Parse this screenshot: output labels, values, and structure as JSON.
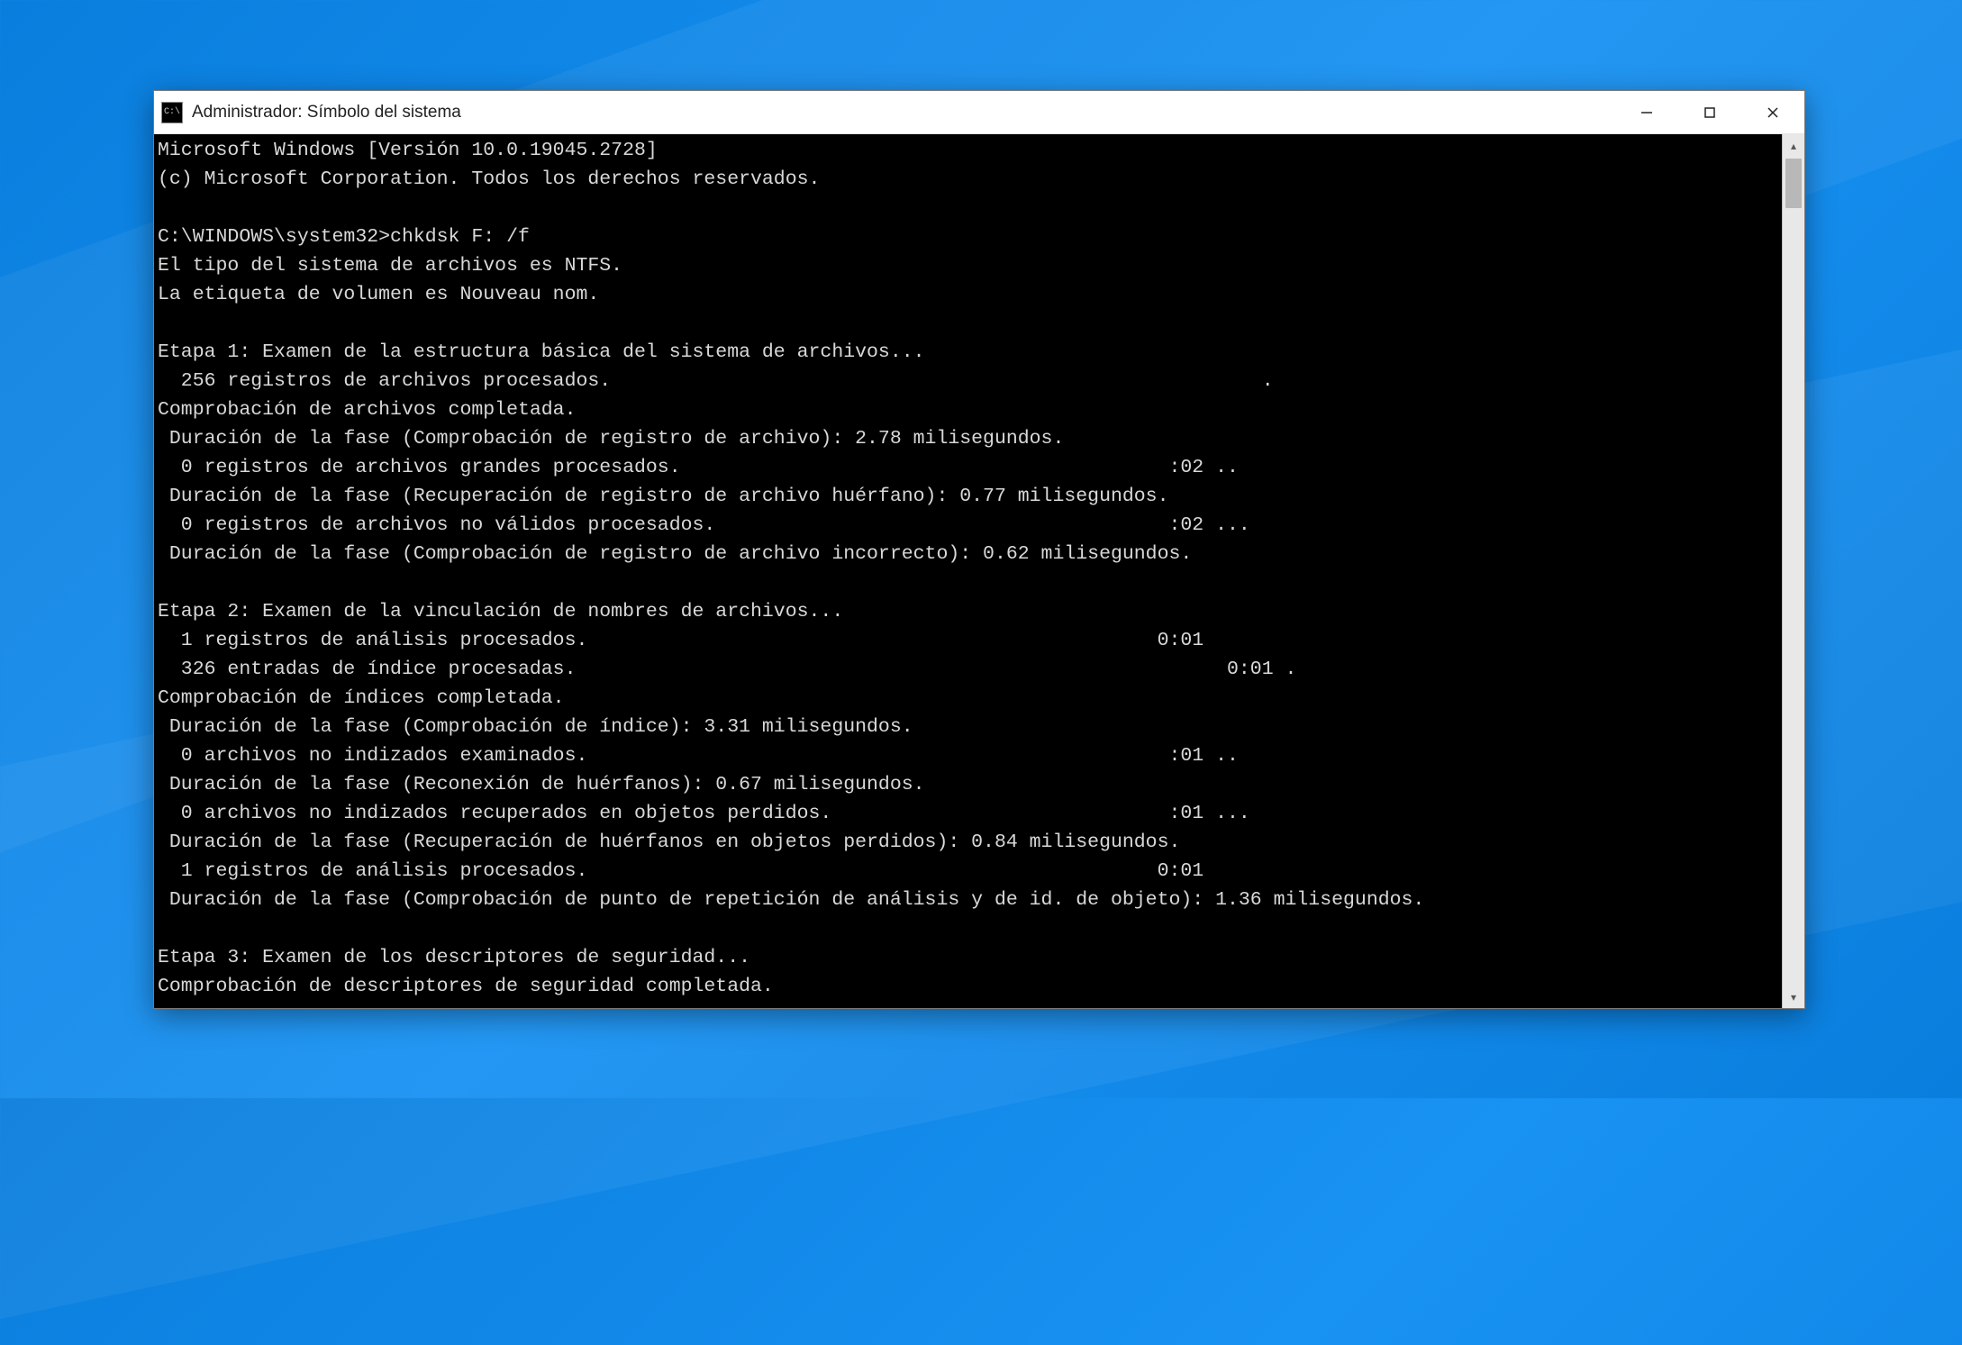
{
  "window": {
    "title": "Administrador: Símbolo del sistema",
    "icon_text": "C:\\"
  },
  "terminal": {
    "lines": [
      "Microsoft Windows [Versión 10.0.19045.2728]",
      "(c) Microsoft Corporation. Todos los derechos reservados.",
      "",
      "C:\\WINDOWS\\system32>chkdsk F: /f",
      "El tipo del sistema de archivos es NTFS.",
      "La etiqueta de volumen es Nouveau nom.",
      "",
      "Etapa 1: Examen de la estructura básica del sistema de archivos...",
      "  256 registros de archivos procesados.                                                        .",
      "Comprobación de archivos completada.",
      " Duración de la fase (Comprobación de registro de archivo): 2.78 milisegundos.",
      "  0 registros de archivos grandes procesados.                                          :02 ..",
      " Duración de la fase (Recuperación de registro de archivo huérfano): 0.77 milisegundos.",
      "  0 registros de archivos no válidos procesados.                                       :02 ...",
      " Duración de la fase (Comprobación de registro de archivo incorrecto): 0.62 milisegundos.",
      "",
      "Etapa 2: Examen de la vinculación de nombres de archivos...",
      "  1 registros de análisis procesados.                                                 0:01",
      "  326 entradas de índice procesadas.                                                        0:01 .",
      "Comprobación de índices completada.",
      " Duración de la fase (Comprobación de índice): 3.31 milisegundos.",
      "  0 archivos no indizados examinados.                                                  :01 ..",
      " Duración de la fase (Reconexión de huérfanos): 0.67 milisegundos.",
      "  0 archivos no indizados recuperados en objetos perdidos.                             :01 ...",
      " Duración de la fase (Recuperación de huérfanos en objetos perdidos): 0.84 milisegundos.",
      "  1 registros de análisis procesados.                                                 0:01",
      " Duración de la fase (Comprobación de punto de repetición de análisis y de id. de objeto): 1.36 milisegundos.",
      "",
      "Etapa 3: Examen de los descriptores de seguridad...",
      "Comprobación de descriptores de seguridad completada."
    ]
  }
}
